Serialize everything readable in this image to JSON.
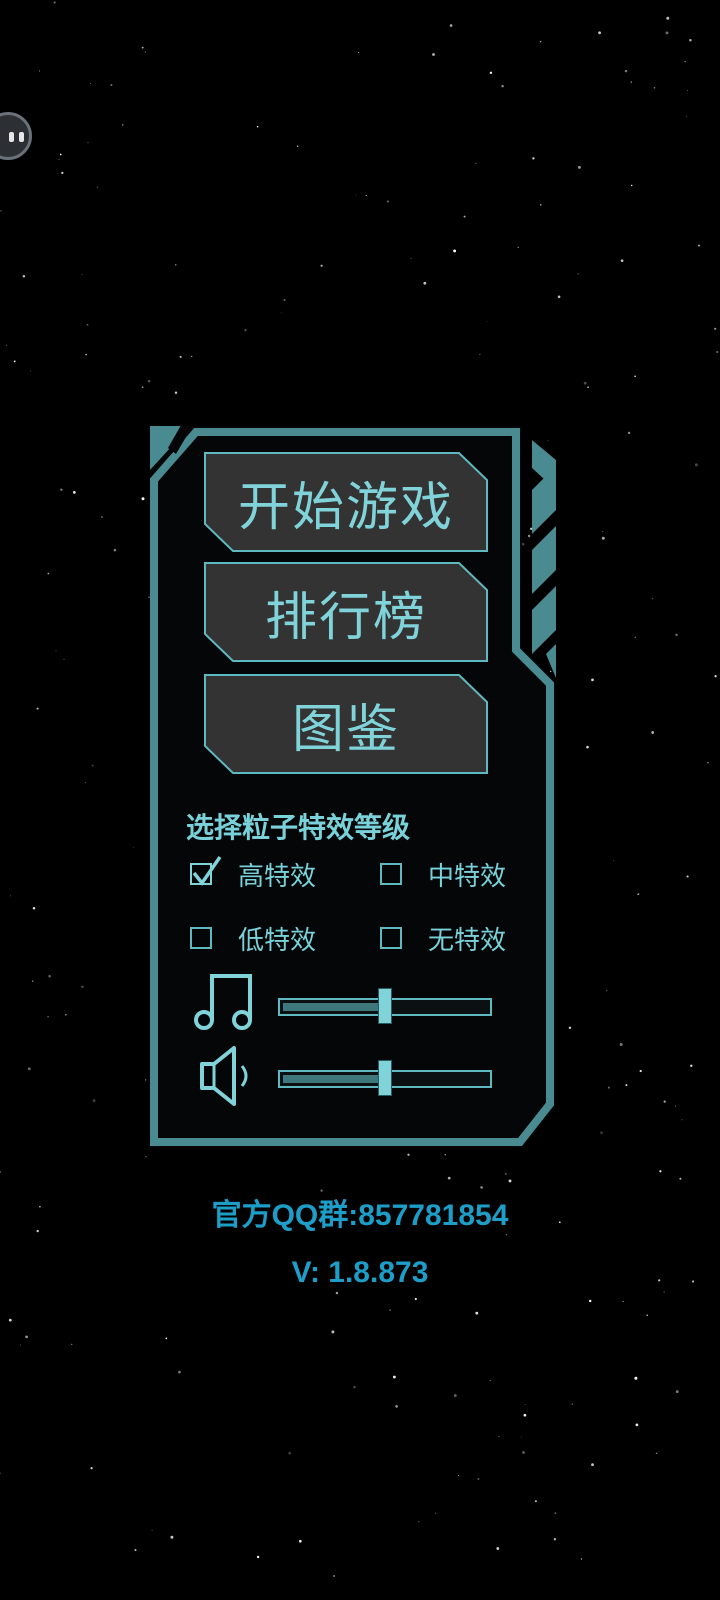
{
  "menu": {
    "start_label": "开始游戏",
    "leaderboard_label": "排行榜",
    "codex_label": "图鉴"
  },
  "effects": {
    "title": "选择粒子特效等级",
    "options": [
      {
        "label": "高特效",
        "checked": true
      },
      {
        "label": "中特效",
        "checked": false
      },
      {
        "label": "低特效",
        "checked": false
      },
      {
        "label": "无特效",
        "checked": false
      }
    ]
  },
  "audio": {
    "music_level": 0.5,
    "sound_level": 0.5
  },
  "footer": {
    "qq_group": "官方QQ群:857781854",
    "version": "V: 1.8.873"
  },
  "colors": {
    "frame": "#4a8a91",
    "accent_text": "#7fd3d9",
    "button_fill": "#333333",
    "footer_text": "#1d9ec9"
  }
}
